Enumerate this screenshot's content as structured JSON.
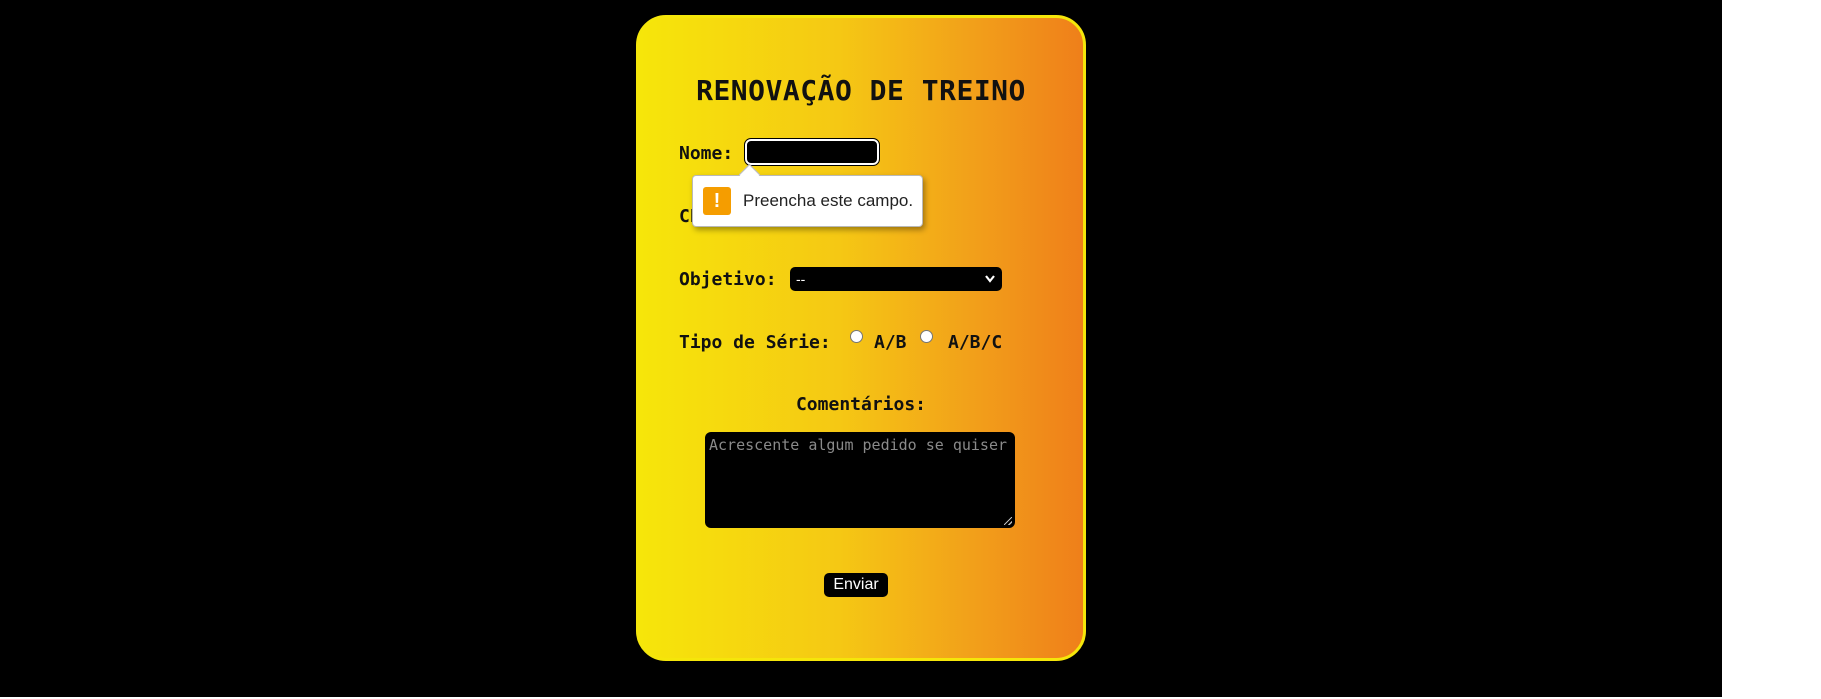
{
  "form": {
    "title": "RENOVAÇÃO DE TREINO",
    "nome_label": "Nome:",
    "nome_value": "",
    "cpf_label": "CPF:",
    "objetivo_label": "Objetivo:",
    "objetivo_selected": "--",
    "serie_label": "Tipo de Série:",
    "serie_options": [
      "A/B",
      "A/B/C"
    ],
    "comentarios_label": "Comentários:",
    "comentarios_placeholder": "Acrescente algum pedido se quiser",
    "submit_label": "Enviar"
  },
  "validation_tooltip": {
    "icon": "warning-icon",
    "icon_glyph": "!",
    "message": "Preencha este campo."
  },
  "colors": {
    "background": "#000000",
    "card_gradient_start": "#f6e60a",
    "card_gradient_end": "#ef7f1a",
    "card_border": "#f5e60a",
    "warning": "#f59d00"
  }
}
